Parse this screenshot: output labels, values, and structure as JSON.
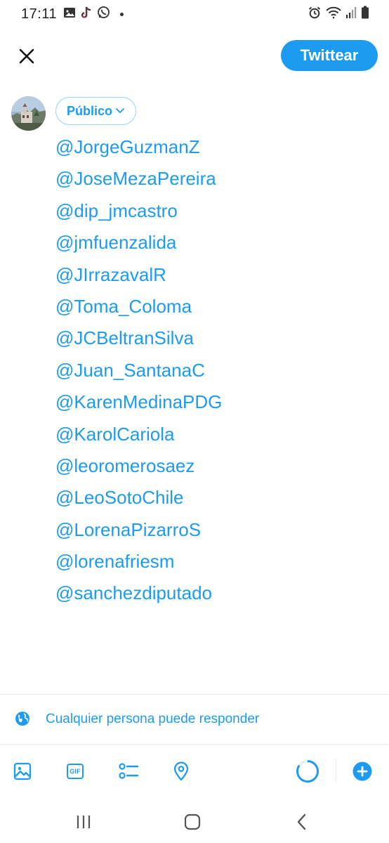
{
  "status_bar": {
    "time": "17:11",
    "left_icons": [
      "image-icon",
      "tiktok-icon",
      "whatsapp-icon",
      "notification-dot-icon"
    ],
    "right_icons": [
      "alarm-icon",
      "wifi-icon",
      "signal-icon",
      "battery-icon"
    ]
  },
  "header": {
    "close_icon": "close-icon",
    "tweet_label": "Twittear"
  },
  "composer": {
    "audience_label": "Público",
    "mentions": [
      "@JorgeGuzmanZ",
      "@JoseMezaPereira",
      "@dip_jmcastro",
      "@jmfuenzalida",
      "@JIrrazavalR",
      "@Toma_Coloma",
      "@JCBeltranSilva",
      "@Juan_SantanaC",
      "@KarenMedinaPDG",
      "@KarolCariola",
      "@leoromerosaez",
      "@LeoSotoChile",
      "@LorenaPizarroS",
      "@lorenafriesm",
      "@sanchezdiputado"
    ]
  },
  "reply_setting": {
    "label": "Cualquier persona puede responder",
    "icon": "globe-icon"
  },
  "toolbar": {
    "gif_label": "GIF",
    "icons": [
      "image-icon",
      "gif-icon",
      "poll-icon",
      "location-icon",
      "character-count-icon",
      "add-thread-icon"
    ]
  },
  "nav_bar": {
    "icons": [
      "recents-icon",
      "home-icon",
      "back-icon"
    ]
  },
  "colors": {
    "accent": "#1d9bf0",
    "text_dark": "#222222",
    "divider": "#e6ecf0"
  }
}
